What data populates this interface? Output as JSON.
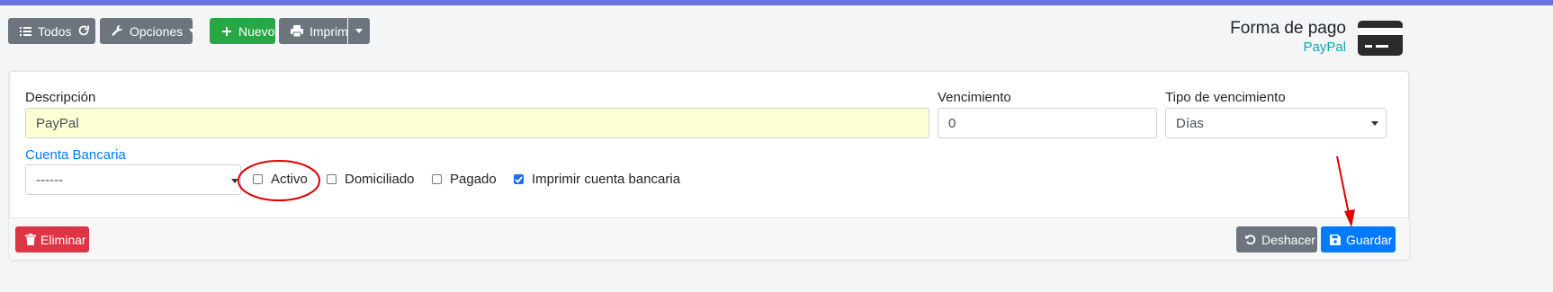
{
  "toolbar": {
    "all_label": "Todos",
    "options_label": "Opciones",
    "new_label": "Nuevo",
    "print_label": "Imprimir"
  },
  "header": {
    "title": "Forma de pago",
    "subtitle": "PayPal"
  },
  "form": {
    "description_label": "Descripción",
    "description_value": "PayPal",
    "due_label": "Vencimiento",
    "due_value": "0",
    "due_type_label": "Tipo de vencimiento",
    "due_type_value": "Días",
    "bank_account_label": "Cuenta Bancaria",
    "bank_account_value": "------",
    "checkboxes": [
      {
        "label": "Activo",
        "checked": false
      },
      {
        "label": "Domiciliado",
        "checked": false
      },
      {
        "label": "Pagado",
        "checked": false
      },
      {
        "label": "Imprimir cuenta bancaria",
        "checked": true
      }
    ]
  },
  "footer": {
    "delete_label": "Eliminar",
    "undo_label": "Deshacer",
    "save_label": "Guardar"
  },
  "colors": {
    "top_stripe": "#6872e0",
    "secondary": "#6c757d",
    "success": "#28a745",
    "danger": "#dc3545",
    "primary": "#007bff",
    "info_text": "#17a2b8",
    "highlight_input": "#ffffd4",
    "annotation": "#e00000"
  },
  "icons": {
    "all": "list-icon",
    "refresh": "refresh-icon",
    "options": "wrench-icon",
    "new": "plus-icon",
    "print": "printer-icon",
    "page": "credit-card-icon",
    "delete": "trash-icon",
    "undo": "undo-icon",
    "save": "floppy-disk-icon"
  }
}
